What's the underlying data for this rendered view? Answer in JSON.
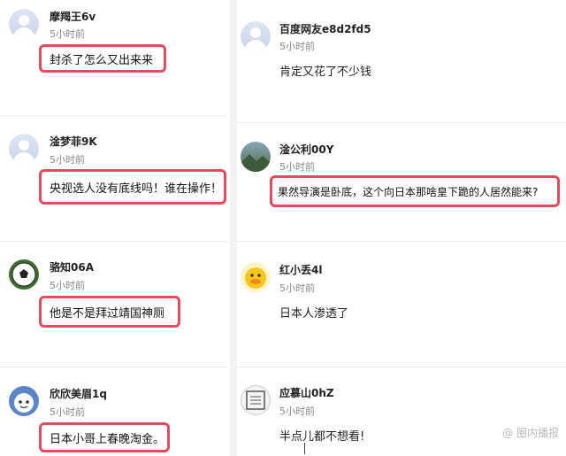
{
  "comments": [
    {
      "username": "摩羯王6v",
      "time": "5小时前",
      "text": "封杀了怎么又出来来"
    },
    {
      "username": "百度网友e8d2fd5",
      "time": "5小时前",
      "text": "肯定又花了不少钱"
    },
    {
      "username": "淦梦菲9K",
      "time": "5小时前",
      "text": "央视选人没有底线吗！谁在操作！"
    },
    {
      "username": "淦公利00Y",
      "time": "5小时前",
      "text": "果然导演是卧底，这个向日本那啥皇下跪的人居然能来?"
    },
    {
      "username": "骆知06A",
      "time": "5小时前",
      "text": "他是不是拜过靖国神厕"
    },
    {
      "username": "红小丢4l",
      "time": "5小时前",
      "text": "日本人渗透了"
    },
    {
      "username": "欣欣美眉1q",
      "time": "5小时前",
      "text": "日本小哥上春晚淘金。"
    },
    {
      "username": "应慕山0hZ",
      "time": "5小时前",
      "text": "半点儿都不想看!"
    }
  ],
  "avatars": {
    "c0": "default-user-icon",
    "c1": "default-user-icon",
    "c2": "default-user-icon",
    "c3": "landscape-photo",
    "c4": "soccer-ball",
    "c5": "yellow-duck",
    "c6": "cartoon-face",
    "c7": "seal-stamp"
  },
  "watermark": {
    "text": "@ 圈内播报"
  },
  "colors": {
    "highlight_border": "#e34b5a",
    "time_text": "#888888"
  }
}
